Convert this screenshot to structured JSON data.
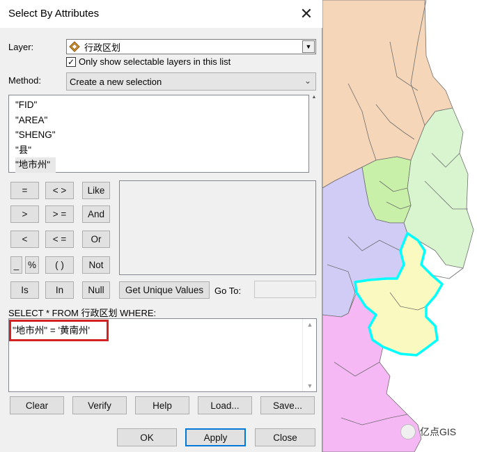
{
  "dialog": {
    "title": "Select By Attributes",
    "close_glyph": "✕",
    "layer_label": "Layer:",
    "layer_value": "行政区划",
    "only_selectable_label": "Only show selectable layers in this list",
    "only_selectable_checked": true,
    "check_glyph": "✓",
    "method_label": "Method:",
    "method_value": "Create a new selection",
    "fields": [
      "\"FID\"",
      "\"AREA\"",
      "\"SHENG\"",
      "\"县\"",
      "\"地市州\""
    ],
    "selected_field": "\"地市州\"",
    "operators": {
      "equals": "=",
      "not_equal": "< >",
      "like": "Like",
      "greater": ">",
      "greater_equal": "> =",
      "and": "And",
      "less": "<",
      "less_equal": "< =",
      "or": "Or",
      "underscore": "_",
      "percent": "%",
      "parens": "( )",
      "not": "Not",
      "is": "Is",
      "in": "In",
      "null": "Null"
    },
    "get_unique_values_label": "Get Unique Values",
    "goto_label": "Go To:",
    "goto_value": "",
    "sql_prefix": "SELECT * FROM 行政区划 WHERE:",
    "sql_expression": "\"地市州\" = '黄南州'",
    "buttons": {
      "clear": "Clear",
      "verify": "Verify",
      "help": "Help",
      "load": "Load...",
      "save": "Save...",
      "ok": "OK",
      "apply": "Apply",
      "close": "Close"
    }
  },
  "watermark": {
    "text": "亿点GIS"
  },
  "map_colors": {
    "tan": "#f5d6b8",
    "light_green": "#d8f5d0",
    "green": "#c8f0a8",
    "purple": "#d0ccf5",
    "yellow_selected": "#fafac0",
    "selection_outline": "#00ffff",
    "magenta": "#f5b8f5"
  }
}
